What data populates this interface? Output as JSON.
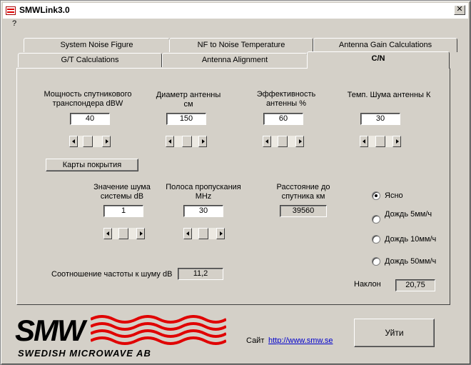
{
  "window": {
    "title": "SMWLink3.0",
    "close_glyph": "✕"
  },
  "menu": {
    "help": "?"
  },
  "tabs": {
    "row1": [
      "System Noise Figure",
      "NF to Noise Temperature",
      "Antenna Gain Calculations"
    ],
    "row2": [
      "G/T Calculations",
      "Antenna Alignment",
      "C/N"
    ],
    "active": "C/N"
  },
  "fields": {
    "transponder_power": {
      "label": "Мощность спутникового транспондера  dBW",
      "value": "40",
      "slider": 0.35
    },
    "antenna_diameter": {
      "label": "Диаметр антенны см",
      "value": "150",
      "slider": 0.55
    },
    "antenna_efficiency": {
      "label": "Эффективность антенны %",
      "value": "60",
      "slider": 0.45
    },
    "antenna_temp": {
      "label": "Темп. Шума антенны К",
      "value": "30",
      "slider": 0.5
    },
    "system_noise": {
      "label": "Значение шума системы  dB",
      "value": "1",
      "slider": 0.45
    },
    "bandwidth": {
      "label": "Полоса пропускания MHz",
      "value": "30",
      "slider": 0.45
    },
    "distance": {
      "label": "Расстояние до спутника  км",
      "value": "39560"
    },
    "cn_ratio": {
      "label": "Соотношение частоты к шуму dB",
      "value": "11,2"
    },
    "slope": {
      "label": "Наклон",
      "value": "20,75"
    }
  },
  "coverage_button": "Карты покрытия",
  "weather": {
    "options": [
      "Ясно",
      "Дождь 5мм/ч",
      "Дождь 10мм/ч",
      "Дождь 50мм/ч"
    ],
    "selected": "Ясно"
  },
  "footer": {
    "logo_main": "SMW",
    "logo_sub": "SWEDISH MICROWAVE AB",
    "site_label": "Сайт",
    "site_url": "http://www.smw.se",
    "exit_button": "Уйти"
  },
  "colors": {
    "wave_red": "#e00000",
    "link": "#0000cc",
    "face": "#d4d0c8"
  }
}
